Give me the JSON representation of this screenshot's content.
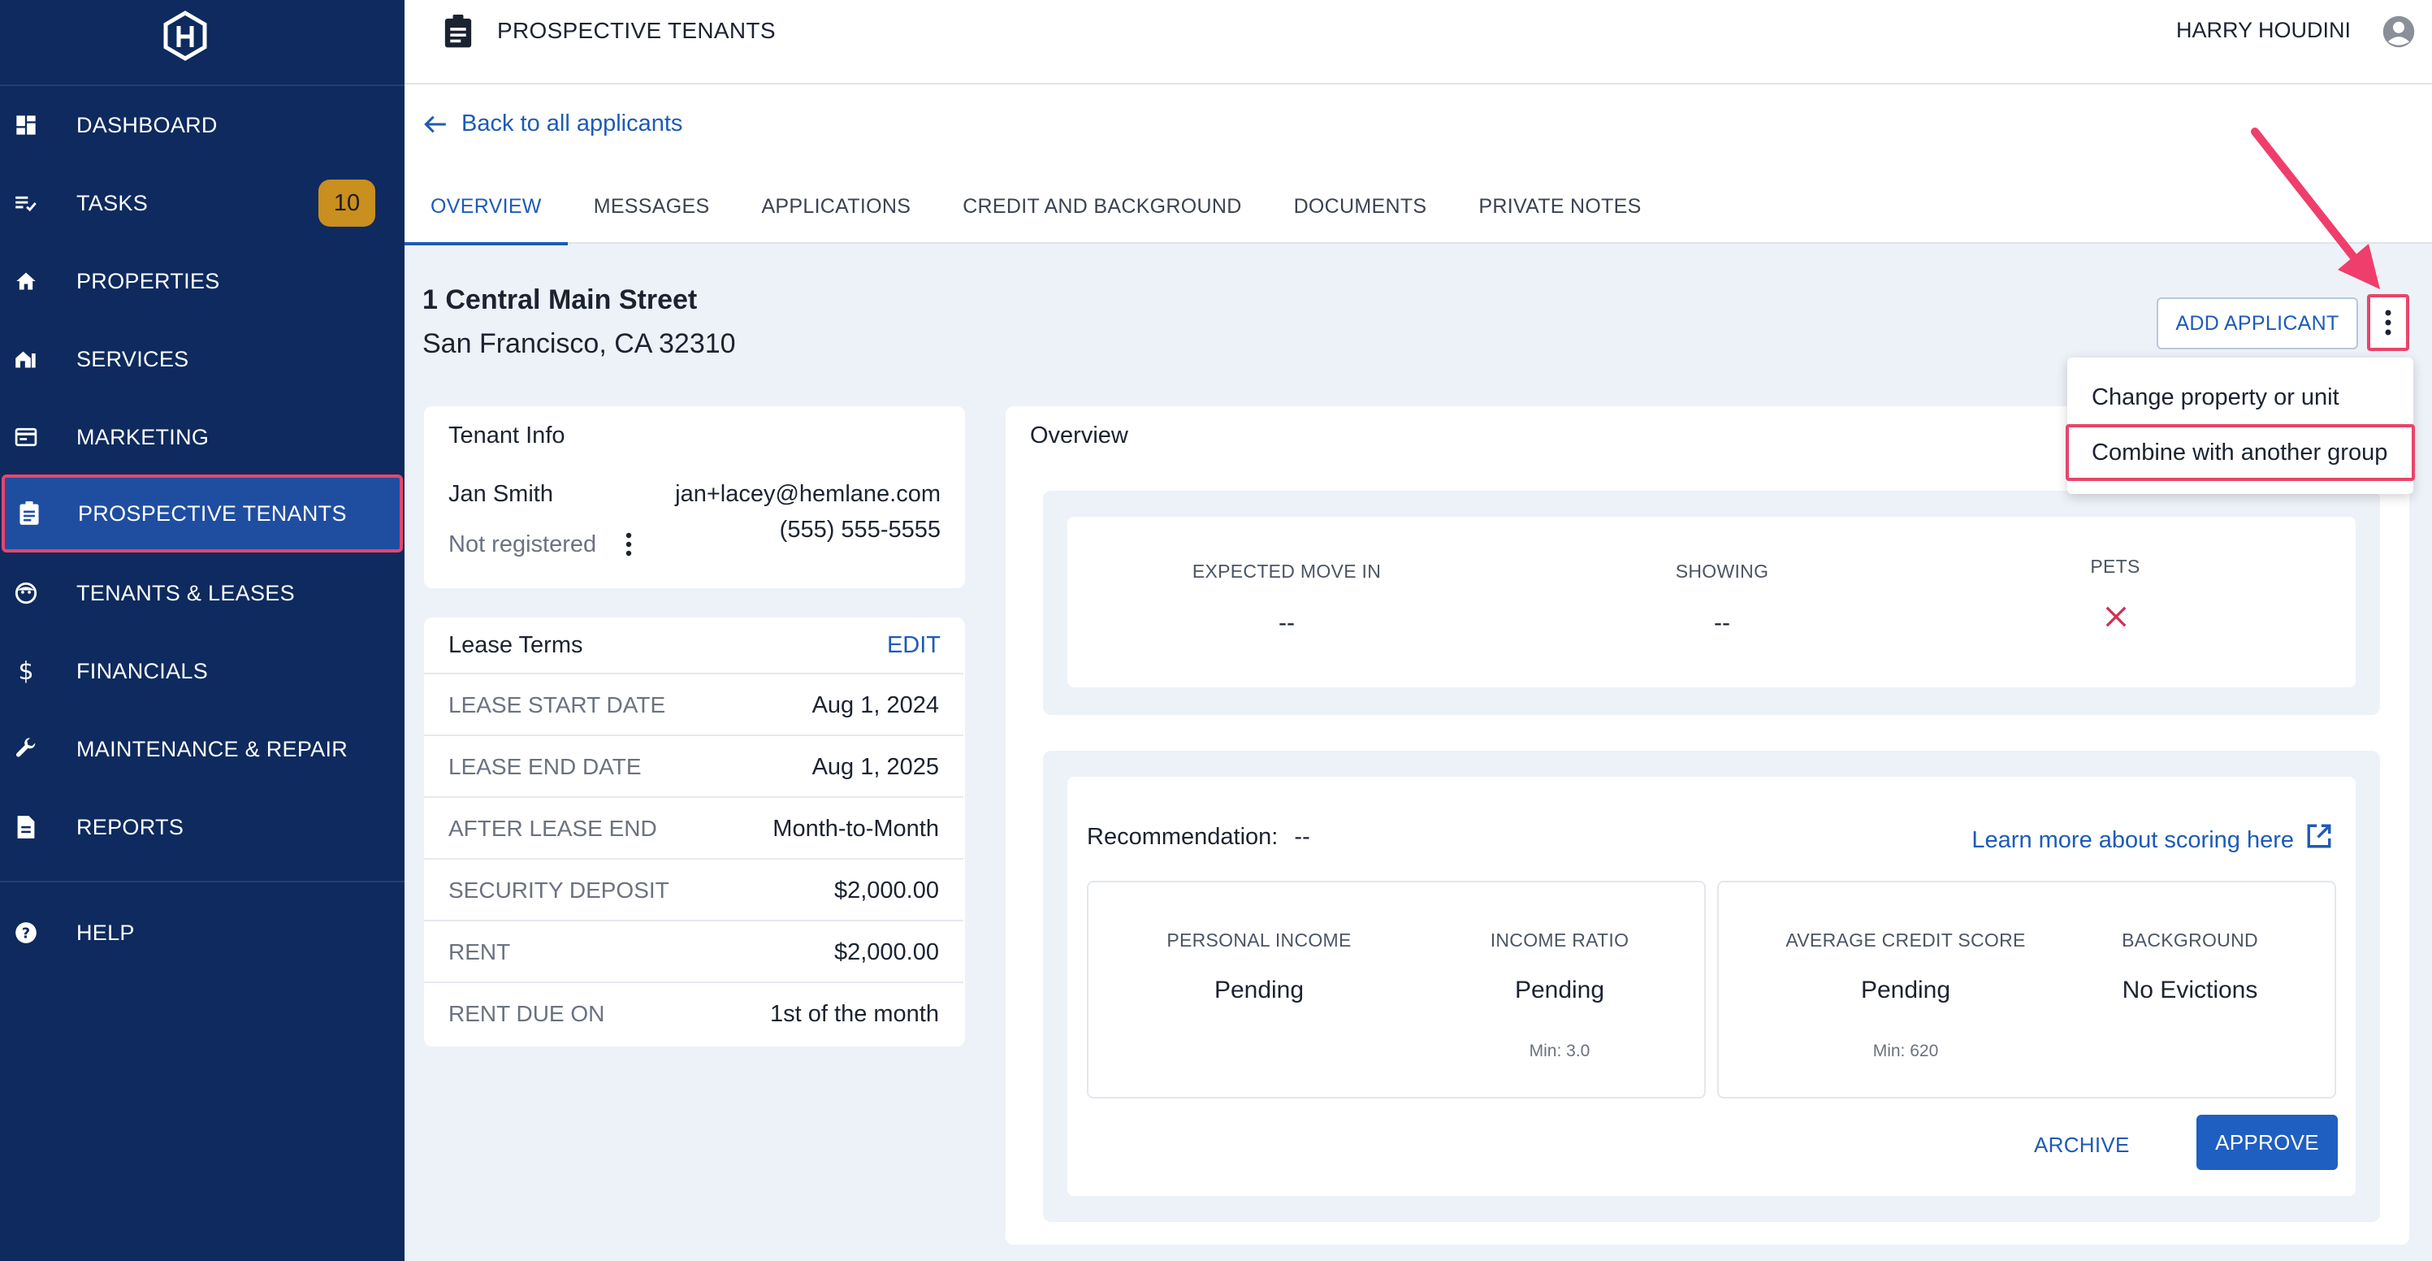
{
  "sidebar": {
    "items": [
      {
        "label": "DASHBOARD",
        "icon": "dashboard-icon"
      },
      {
        "label": "TASKS",
        "icon": "tasks-icon",
        "badge": "10"
      },
      {
        "label": "PROPERTIES",
        "icon": "home-icon"
      },
      {
        "label": "SERVICES",
        "icon": "services-icon"
      },
      {
        "label": "MARKETING",
        "icon": "marketing-icon"
      },
      {
        "label": "PROSPECTIVE TENANTS",
        "icon": "clipboard-icon",
        "active": true
      },
      {
        "label": "TENANTS & LEASES",
        "icon": "tenants-icon"
      },
      {
        "label": "FINANCIALS",
        "icon": "dollar-icon"
      },
      {
        "label": "MAINTENANCE & REPAIR",
        "icon": "wrench-icon"
      },
      {
        "label": "REPORTS",
        "icon": "reports-icon"
      }
    ],
    "help": {
      "label": "HELP",
      "icon": "help-icon"
    }
  },
  "header": {
    "title": "PROSPECTIVE TENANTS",
    "user_name": "HARRY HOUDINI"
  },
  "subheader": {
    "back_label": "Back to all applicants",
    "tabs": [
      "OVERVIEW",
      "MESSAGES",
      "APPLICATIONS",
      "CREDIT AND BACKGROUND",
      "DOCUMENTS",
      "PRIVATE NOTES"
    ],
    "active_tab": "OVERVIEW"
  },
  "property": {
    "line1": "1 Central Main Street",
    "line2": "San Francisco, CA 32310"
  },
  "actions": {
    "add_applicant": "ADD APPLICANT",
    "menu": [
      "Change property or unit",
      "Combine with another group"
    ],
    "highlighted_menu_item": "Combine with another group"
  },
  "tenant_info": {
    "title": "Tenant Info",
    "name": "Jan Smith",
    "status": "Not registered",
    "email": "jan+lacey@hemlane.com",
    "phone": "(555) 555-5555"
  },
  "lease_terms": {
    "title": "Lease Terms",
    "edit_label": "EDIT",
    "rows": [
      {
        "key": "LEASE START DATE",
        "value": "Aug 1, 2024"
      },
      {
        "key": "LEASE END DATE",
        "value": "Aug 1, 2025"
      },
      {
        "key": "AFTER LEASE END",
        "value": "Month-to-Month"
      },
      {
        "key": "SECURITY DEPOSIT",
        "value": "$2,000.00"
      },
      {
        "key": "RENT",
        "value": "$2,000.00"
      },
      {
        "key": "RENT DUE ON",
        "value": "1st of the month"
      }
    ]
  },
  "overview": {
    "title": "Overview",
    "expected_move_in": {
      "label": "EXPECTED MOVE IN",
      "value": "--"
    },
    "showing": {
      "label": "SHOWING",
      "value": "--"
    },
    "pets": {
      "label": "PETS",
      "value_icon": "x-icon"
    },
    "recommendation_label": "Recommendation:",
    "recommendation_value": "--",
    "learn_more": "Learn more about scoring here",
    "metrics": [
      {
        "label": "PERSONAL INCOME",
        "value": "Pending",
        "min": ""
      },
      {
        "label": "INCOME RATIO",
        "value": "Pending",
        "min": "Min: 3.0"
      },
      {
        "label": "AVERAGE CREDIT SCORE",
        "value": "Pending",
        "min": "Min: 620"
      },
      {
        "label": "BACKGROUND",
        "value": "No Evictions",
        "min": ""
      }
    ],
    "archive_label": "ARCHIVE",
    "approve_label": "APPROVE"
  },
  "colors": {
    "sidebar_bg": "#0e2a5e",
    "active_bg": "#1f4ea1",
    "accent_blue": "#1d5bb8",
    "highlight_pink": "#e8456a",
    "badge": "#c98f1f"
  }
}
